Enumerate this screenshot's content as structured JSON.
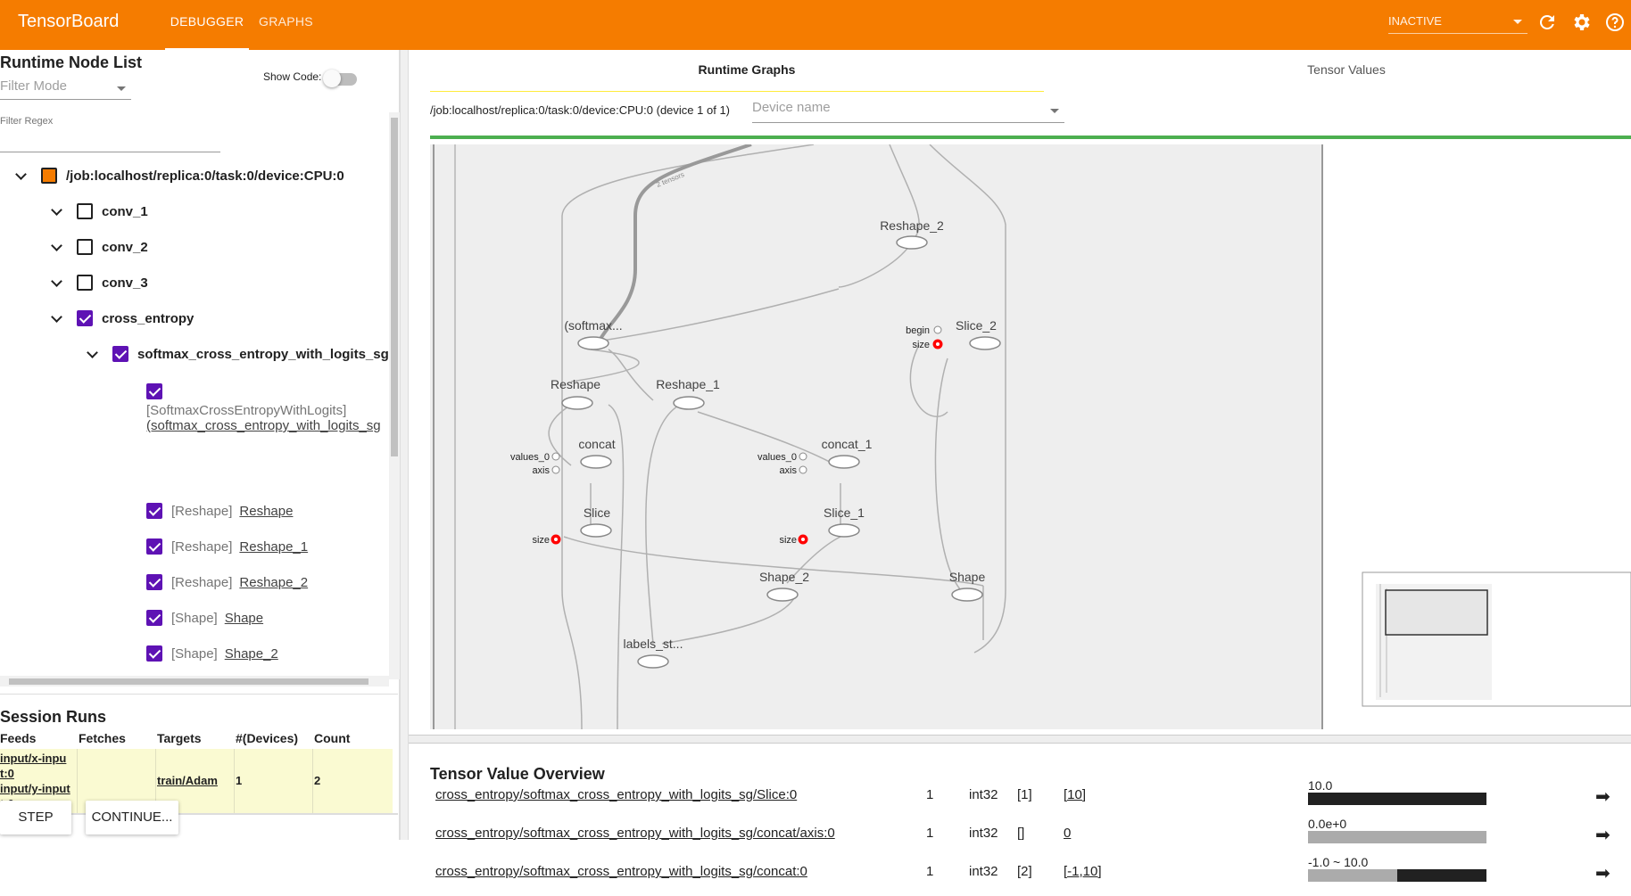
{
  "app": {
    "title": "TensorBoard"
  },
  "nav": {
    "tabs": [
      {
        "label": "DEBUGGER"
      },
      {
        "label": "GRAPHS"
      }
    ],
    "run_select": "INACTIVE"
  },
  "left": {
    "title": "Runtime Node List",
    "filter_mode_placeholder": "Filter Mode",
    "show_code_label": "Show Code:",
    "filter_regex_label": "Filter Regex",
    "tree": {
      "device": "/job:localhost/replica:0/task:0/device:CPU:0",
      "groups": [
        "conv_1",
        "conv_2",
        "conv_3",
        "cross_entropy"
      ],
      "subgroup": "softmax_cross_entropy_with_logits_sg",
      "first_op_type": "[SoftmaxCrossEntropyWithLogits]",
      "first_op_name": "(softmax_cross_entropy_with_logits_sg",
      "ops": [
        {
          "type": "[Reshape]",
          "name": "Reshape"
        },
        {
          "type": "[Reshape]",
          "name": "Reshape_1"
        },
        {
          "type": "[Reshape]",
          "name": "Reshape_2"
        },
        {
          "type": "[Shape]",
          "name": "Shape"
        },
        {
          "type": "[Shape]",
          "name": "Shape_2"
        }
      ]
    },
    "session": {
      "title": "Session Runs",
      "headers": [
        "Feeds",
        "Fetches",
        "Targets",
        "#(Devices)",
        "Count"
      ],
      "row": {
        "feeds_1": "input/x-inpu",
        "feeds_1b": "t:0",
        "feeds_2": "input/y-input",
        "feeds_2b": "t:0",
        "fetches": "",
        "targets": "train/Adam",
        "devices": "1",
        "count": "2"
      }
    },
    "buttons": {
      "step": "STEP",
      "continue": "CONTINUE..."
    }
  },
  "right": {
    "tabs": [
      "Runtime Graphs",
      "Tensor Values"
    ],
    "device_path": "/job:localhost/replica:0/task:0/device:CPU:0 (device 1 of 1)",
    "device_name_placeholder": "Device name",
    "graph": {
      "edge_label": "2 tensors",
      "nodes": [
        "Reshape_2",
        "(softmax...",
        "Slice_2",
        "Reshape",
        "Reshape_1",
        "concat",
        "concat_1",
        "Slice",
        "Slice_1",
        "Shape_2",
        "Shape",
        "labels_st..."
      ],
      "const_labels": [
        "begin",
        "size",
        "values_0",
        "axis",
        "values_0",
        "axis",
        "size",
        "size"
      ]
    },
    "overview": {
      "title": "Tensor Value Overview",
      "rows": [
        {
          "name": "cross_entropy/softmax_cross_entropy_with_logits_sg/Slice:0",
          "count": "1",
          "dtype": "int32",
          "shape": "[1]",
          "value": "[10]",
          "summary": "10.0",
          "bar_fraction": 1.0
        },
        {
          "name": "cross_entropy/softmax_cross_entropy_with_logits_sg/concat/axis:0",
          "count": "1",
          "dtype": "int32",
          "shape": "[]",
          "value": "0",
          "summary": "0.0e+0",
          "bar_fraction": 0
        },
        {
          "name": "cross_entropy/softmax_cross_entropy_with_logits_sg/concat:0",
          "count": "1",
          "dtype": "int32",
          "shape": "[2]",
          "value": "[-1,10]",
          "summary": "-1.0 ~ 10.0",
          "bar_fraction": 0.5
        }
      ]
    }
  },
  "colors": {
    "header": "#f57c00",
    "checkbox": "#5e12b4",
    "green_bar": "#4caf50",
    "error_node": "#ff0000"
  }
}
